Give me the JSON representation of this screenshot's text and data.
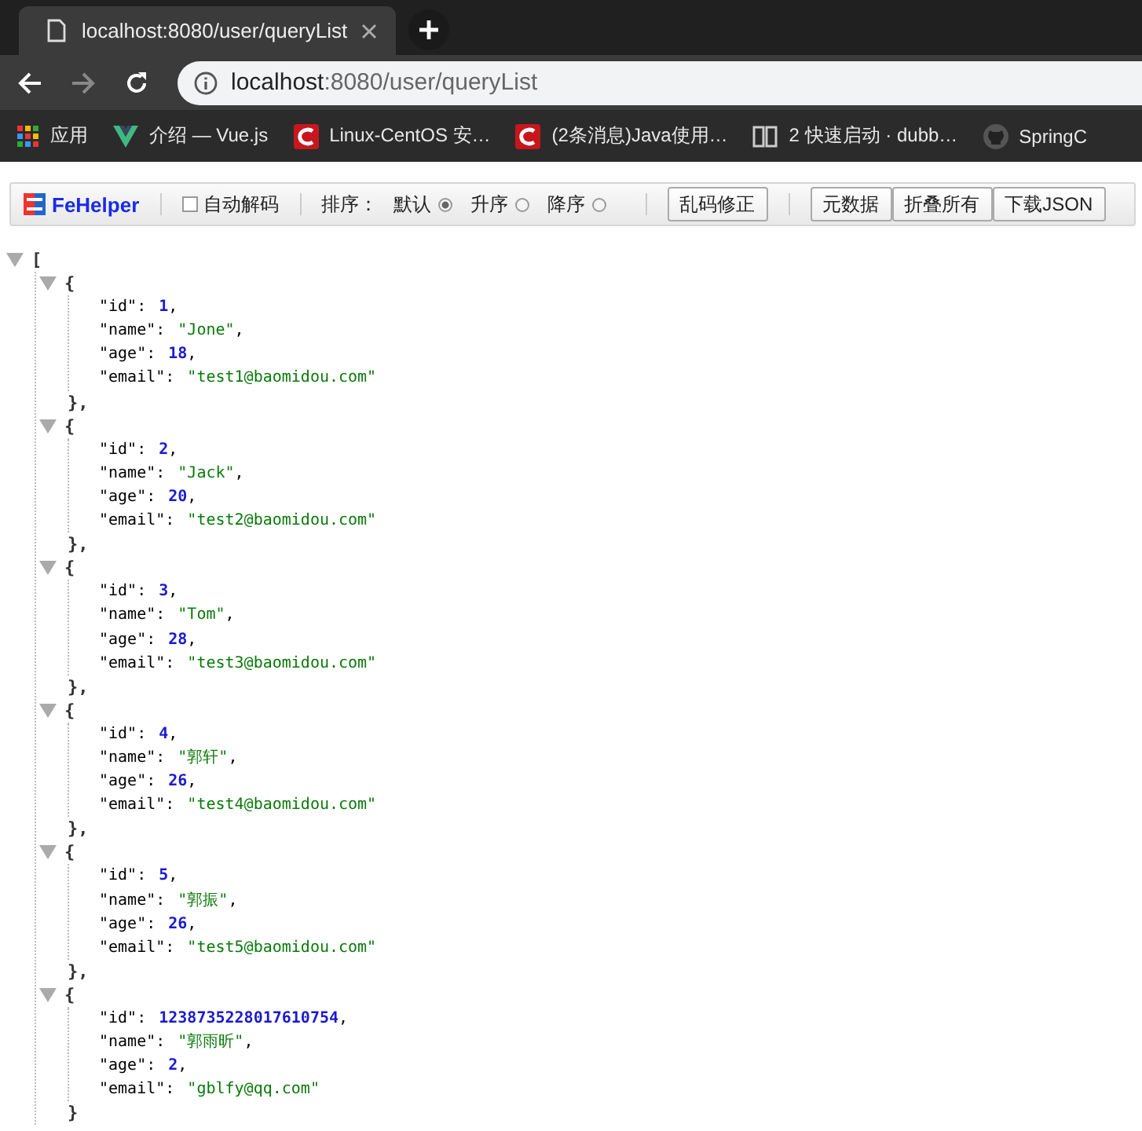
{
  "tab": {
    "title": "localhost:8080/user/queryList"
  },
  "address_bar": {
    "host": "localhost",
    "path": ":8080/user/queryList"
  },
  "bookmarks": [
    {
      "label": "应用",
      "kind": "apps"
    },
    {
      "label": "介绍 — Vue.js",
      "kind": "vue"
    },
    {
      "label": "Linux-CentOS 安…",
      "kind": "csdn"
    },
    {
      "label": "(2条消息)Java使用…",
      "kind": "csdn"
    },
    {
      "label": "2 快速启动 · dubb…",
      "kind": "book"
    },
    {
      "label": "SpringC",
      "kind": "github"
    }
  ],
  "fehelper": {
    "brand": "FeHelper",
    "auto_decode": {
      "label": "自动解码",
      "checked": false
    },
    "sort_label": "排序：",
    "sort_options": [
      {
        "label": "默认",
        "selected": true
      },
      {
        "label": "升序",
        "selected": false
      },
      {
        "label": "降序",
        "selected": false
      }
    ],
    "fix_button": "乱码修正",
    "buttons": [
      "元数据",
      "折叠所有",
      "下载JSON"
    ]
  },
  "json_view": {
    "open": "[",
    "expanded": true,
    "items": [
      {
        "open": "{",
        "close": "},",
        "expanded": true,
        "fields": [
          {
            "key": "\"id\":",
            "value": "1",
            "kind": "number",
            "comma": ","
          },
          {
            "key": "\"name\":",
            "value": "\"Jone\"",
            "kind": "string",
            "comma": ","
          },
          {
            "key": "\"age\":",
            "value": "18",
            "kind": "number",
            "comma": ","
          },
          {
            "key": "\"email\":",
            "value": "\"test1@baomidou.com\"",
            "kind": "string"
          }
        ]
      },
      {
        "open": "{",
        "close": "},",
        "expanded": true,
        "fields": [
          {
            "key": "\"id\":",
            "value": "2",
            "kind": "number",
            "comma": ","
          },
          {
            "key": "\"name\":",
            "value": "\"Jack\"",
            "kind": "string",
            "comma": ","
          },
          {
            "key": "\"age\":",
            "value": "20",
            "kind": "number",
            "comma": ","
          },
          {
            "key": "\"email\":",
            "value": "\"test2@baomidou.com\"",
            "kind": "string"
          }
        ]
      },
      {
        "open": "{",
        "close": "},",
        "expanded": true,
        "fields": [
          {
            "key": "\"id\":",
            "value": "3",
            "kind": "number",
            "comma": ","
          },
          {
            "key": "\"name\":",
            "value": "\"Tom\"",
            "kind": "string",
            "comma": ","
          },
          {
            "key": "\"age\":",
            "value": "28",
            "kind": "number",
            "comma": ","
          },
          {
            "key": "\"email\":",
            "value": "\"test3@baomidou.com\"",
            "kind": "string"
          }
        ]
      },
      {
        "open": "{",
        "close": "},",
        "expanded": true,
        "fields": [
          {
            "key": "\"id\":",
            "value": "4",
            "kind": "number",
            "comma": ","
          },
          {
            "key": "\"name\":",
            "value": "\"郭轩\"",
            "kind": "string",
            "comma": ","
          },
          {
            "key": "\"age\":",
            "value": "26",
            "kind": "number",
            "comma": ","
          },
          {
            "key": "\"email\":",
            "value": "\"test4@baomidou.com\"",
            "kind": "string"
          }
        ]
      },
      {
        "open": "{",
        "close": "},",
        "expanded": true,
        "fields": [
          {
            "key": "\"id\":",
            "value": "5",
            "kind": "number",
            "comma": ","
          },
          {
            "key": "\"name\":",
            "value": "\"郭振\"",
            "kind": "string",
            "comma": ","
          },
          {
            "key": "\"age\":",
            "value": "26",
            "kind": "number",
            "comma": ","
          },
          {
            "key": "\"email\":",
            "value": "\"test5@baomidou.com\"",
            "kind": "string"
          }
        ]
      },
      {
        "open": "{",
        "close": "}",
        "expanded": true,
        "fields": [
          {
            "key": "\"id\":",
            "value": "1238735228017610754",
            "kind": "number",
            "comma": ","
          },
          {
            "key": "\"name\":",
            "value": "\"郭雨昕\"",
            "kind": "string",
            "comma": ","
          },
          {
            "key": "\"age\":",
            "value": "2",
            "kind": "number",
            "comma": ","
          },
          {
            "key": "\"email\":",
            "value": "\"gblfy@qq.com\"",
            "kind": "string"
          }
        ]
      }
    ]
  }
}
